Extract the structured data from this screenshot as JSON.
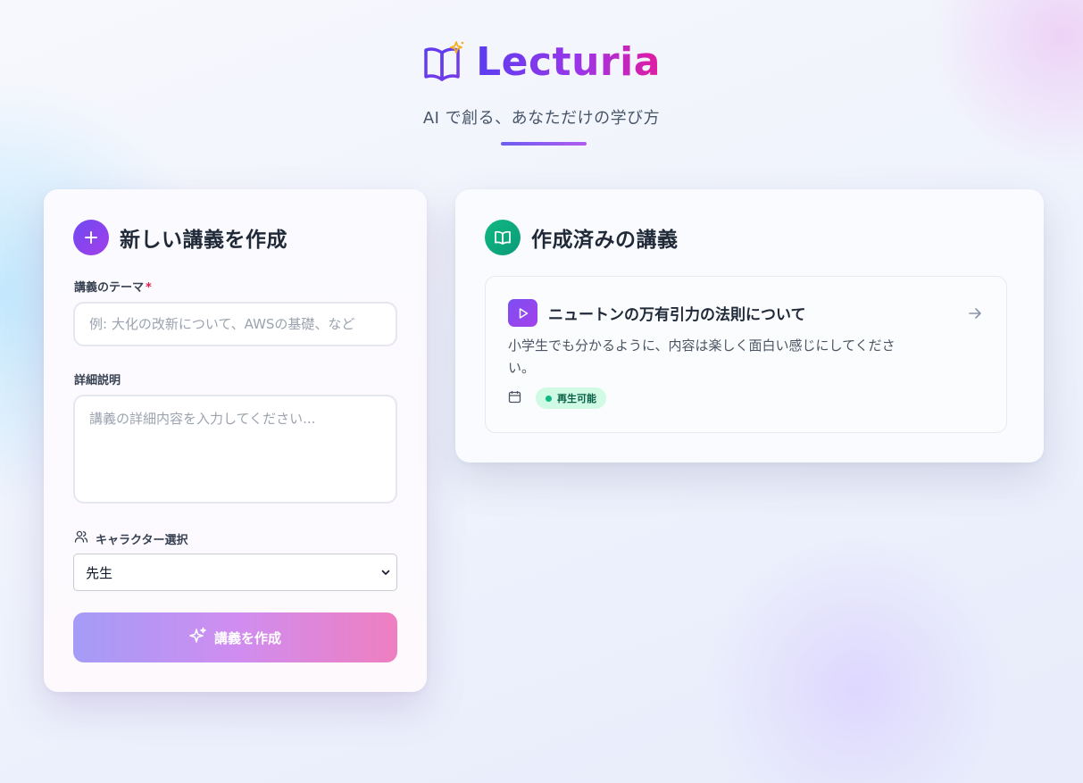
{
  "brand": {
    "name": "Lecturia",
    "tagline": "AI で創る、あなただけの学び方"
  },
  "create_form": {
    "title": "新しい講義を作成",
    "theme_label": "講義のテーマ",
    "required_mark": "*",
    "theme_placeholder": "例: 大化の改新について、AWSの基礎、など",
    "detail_label": "詳細説明",
    "detail_placeholder": "講義の詳細内容を入力してください...",
    "character_label": "キャラクター選択",
    "character_value": "先生",
    "submit_label": "講義を作成"
  },
  "lecture_list": {
    "title": "作成済みの講義",
    "items": [
      {
        "title": "ニュートンの万有引力の法則について",
        "description": "小学生でも分かるように、内容は楽しく面白い感じにしてください。",
        "status": "再生可能"
      }
    ]
  },
  "colors": {
    "brand_gradient_start": "#5b3df0",
    "brand_gradient_end": "#e21ba0",
    "create_badge": "#7c4df2",
    "list_badge": "#10b981",
    "status_bg": "#d1fae5",
    "status_text": "#065f46"
  },
  "icons": {
    "brand": "open-book-sparkle-icon",
    "create_badge": "plus-icon",
    "list_badge": "book-icon",
    "character": "users-icon",
    "submit": "sparkles-icon",
    "lecture": "play-icon",
    "lecture_open": "arrow-right-icon",
    "date": "calendar-icon"
  }
}
